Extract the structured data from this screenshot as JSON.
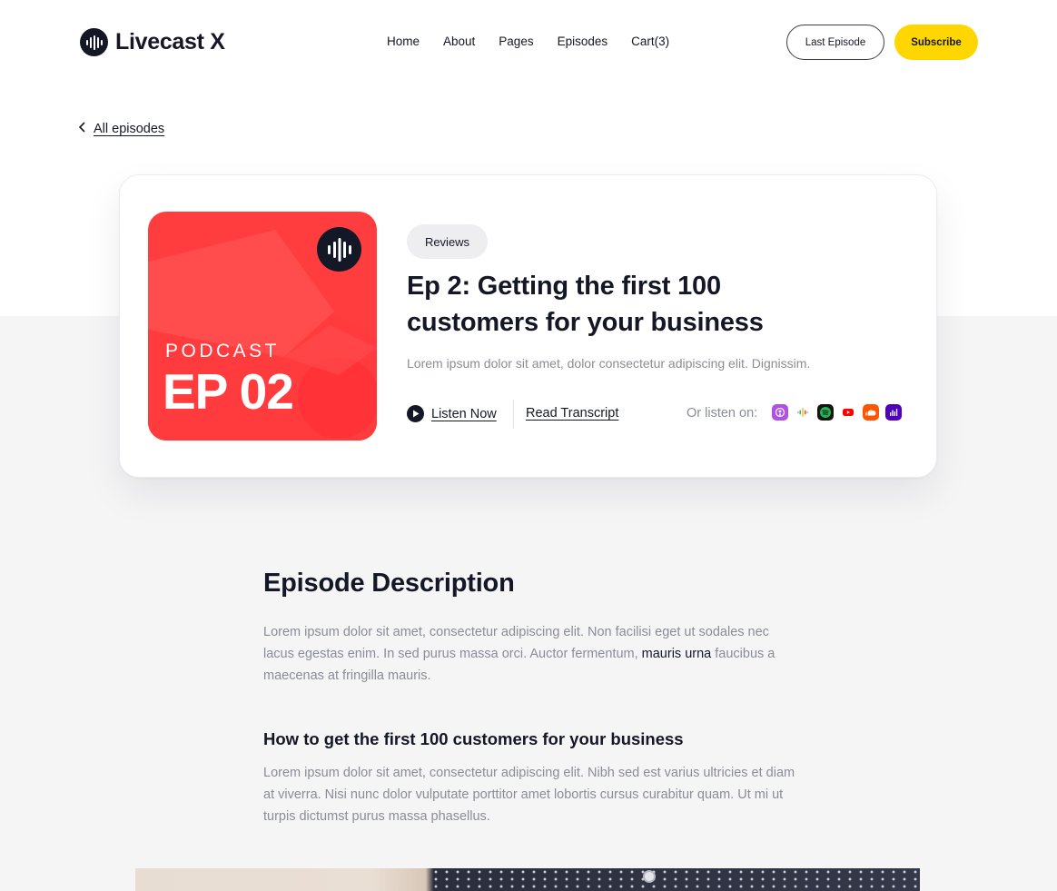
{
  "header": {
    "logo_text": "Livecast X",
    "nav": [
      {
        "label": "Home"
      },
      {
        "label": "About"
      },
      {
        "label": "Pages"
      },
      {
        "label": "Episodes"
      },
      {
        "label": "Cart(3)"
      }
    ],
    "last_episode_label": "Last Episode",
    "subscribe_label": "Subscribe"
  },
  "back_link": {
    "label": "All episodes"
  },
  "episode": {
    "cover_kicker": "PODCAST",
    "cover_title": "EP 02",
    "tag": "Reviews",
    "title": "Ep 2: Getting the first 100 customers for your business",
    "summary": "Lorem ipsum dolor sit amet, dolor consectetur adipiscing elit. Dignissim.",
    "listen_label": "Listen Now",
    "transcript_label": "Read Transcript",
    "or_listen_label": "Or listen on:",
    "platforms": [
      {
        "icon": "apple-podcasts-icon",
        "color": "#b150e2"
      },
      {
        "icon": "google-podcasts-icon",
        "color": "#ffffff"
      },
      {
        "icon": "spotify-icon",
        "color": "#1db954"
      },
      {
        "icon": "youtube-icon",
        "color": "#ff0000"
      },
      {
        "icon": "soundcloud-icon",
        "color": "#ff5500"
      },
      {
        "icon": "anchor-icon",
        "color": "#5000b9"
      }
    ]
  },
  "description": {
    "heading": "Episode Description",
    "para_start": "Lorem ipsum dolor sit amet, consectetur adipiscing elit. Non facilisi eget ut sodales nec lacus egestas enim. In sed purus massa orci. Auctor fermentum, ",
    "para_link": "mauris urna",
    "para_end": " faucibus a maecenas at fringilla mauris.",
    "subheading": "How to get the first 100 customers for your business",
    "sub_para": "Lorem ipsum dolor sit amet, consectetur adipiscing elit. Nibh sed est varius ultricies et diam at viverra. Nisi nunc dolor vulputate porttitor amet lobortis cursus curabitur quam. Ut mi ut turpis dictumst purus massa phasellus."
  },
  "colors": {
    "accent_yellow": "#ffd600",
    "dark": "#141726",
    "cover_red": "#ff3d3f"
  }
}
